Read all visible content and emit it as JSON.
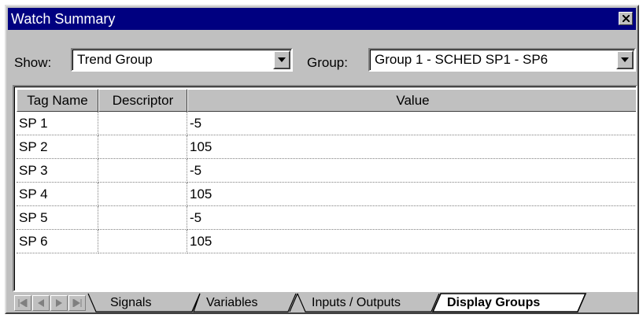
{
  "window": {
    "title": "Watch Summary",
    "close_icon": "close-icon"
  },
  "toolbar": {
    "show_label": "Show:",
    "show_value": "Trend Group",
    "group_label": "Group:",
    "group_value": "Group 1 - SCHED SP1 - SP6"
  },
  "table": {
    "columns": [
      "Tag Name",
      "Descriptor",
      "Value"
    ],
    "rows": [
      {
        "tag": "SP 1",
        "descriptor": "",
        "value": "-5"
      },
      {
        "tag": "SP 2",
        "descriptor": "",
        "value": "105"
      },
      {
        "tag": "SP 3",
        "descriptor": "",
        "value": "-5"
      },
      {
        "tag": "SP 4",
        "descriptor": "",
        "value": "105"
      },
      {
        "tag": "SP 5",
        "descriptor": "",
        "value": "-5"
      },
      {
        "tag": "SP 6",
        "descriptor": "",
        "value": "105"
      }
    ]
  },
  "tabs": {
    "items": [
      "Signals",
      "Variables",
      "Inputs / Outputs",
      "Display Groups"
    ],
    "active": "Display Groups",
    "nav_icons": [
      "first-icon",
      "prev-icon",
      "next-icon",
      "last-icon"
    ]
  }
}
